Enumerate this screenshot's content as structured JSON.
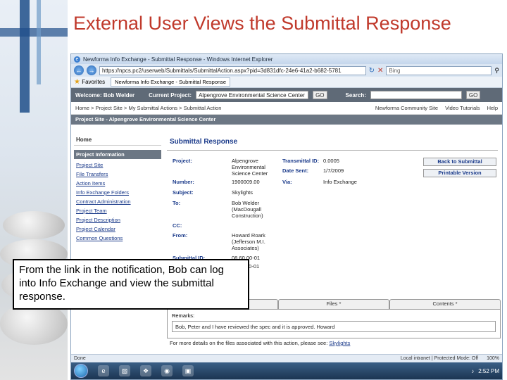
{
  "slide": {
    "title": "External User Views the Submittal Response",
    "callout": "From the link in the notification, Bob can log into Info Exchange and view the submittal response."
  },
  "browser": {
    "window_title": "Newforma Info Exchange - Submittal Response - Windows Internet Explorer",
    "url": "https://npcs.pc2/userweb/Submittals/SubmittalAction.aspx?pid=3d831dfc-24e6-41a2-b682-5781",
    "search_placeholder": "Bing",
    "favorites_label": "Favorites",
    "tab_label": "Newforma Info Exchange - Submittal Response",
    "status_left": "Done",
    "status_zone": "Local intranet | Protected Mode: Off",
    "zoom": "100%",
    "clock": "2:52 PM"
  },
  "app": {
    "welcome": "Welcome: Bob Welder",
    "current_project_label": "Current Project:",
    "current_project_value": "Alpengrove Environmental Science Center",
    "go_label": "GO",
    "search_label": "Search:",
    "breadcrumb": "Home > Project Site > My Submittal Actions > Submittal Action",
    "crumb_links": [
      "Newforma Community Site",
      "Video Tutorials",
      "Help"
    ],
    "site_bar": "Project Site - Alpengrove Environmental Science Center",
    "nav": {
      "home": "Home",
      "section": "Project Information",
      "items": [
        "Project Site",
        "File Transfers",
        "Action Items",
        "Info Exchange Folders",
        "Contract Administration",
        "Project Team",
        "Project Description",
        "Project Calendar",
        "Common Questions"
      ]
    },
    "main": {
      "heading": "Submittal Response",
      "fields": {
        "project_label": "Project:",
        "project_value": "Alpengrove Environmental Science Center",
        "transmittal_label": "Transmittal ID:",
        "transmittal_value": "0.0005",
        "date_sent_label": "Date Sent:",
        "date_sent_value": "1/7/2009",
        "number_label": "Number:",
        "number_value": "1900009.00",
        "via_label": "Via:",
        "via_value": "Info Exchange",
        "subject_label": "Subject:",
        "subject_value": "Skylights",
        "to_label": "To:",
        "to_value": "Bob Welder (MacDougall Construction)",
        "cc_label": "CC:",
        "from_label": "From:",
        "from_value": "Howard Roark (Jefferson M.I. Associates)",
        "submittal_id_label": "Submittal ID:",
        "submittal_id_value": "08 60 00-01",
        "submittal_id_value2": "00-01"
      },
      "back_button": "Back to Submittal",
      "print_button": "Printable Version",
      "tabs": [
        "Files *",
        "Contents *"
      ],
      "remarks_label": "Remarks:",
      "remarks_value": "Bob, Peter and I have reviewed the spec and it is approved. Howard",
      "more_details_text": "For more details on the files associated with this action, please see:",
      "more_details_link": "Skylights"
    }
  }
}
